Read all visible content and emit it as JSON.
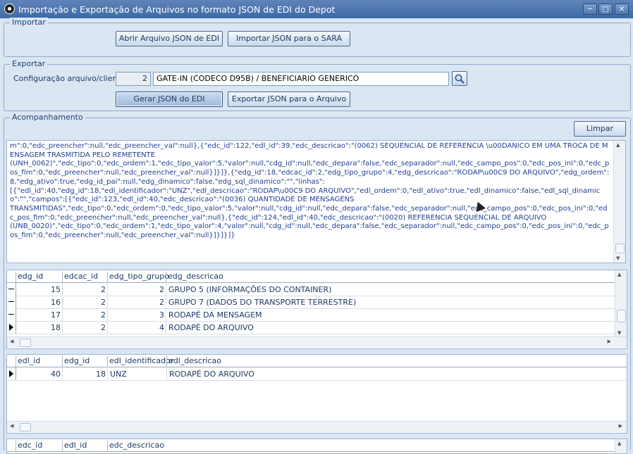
{
  "window": {
    "title": "Importação e Exportação de Arquivos no formato JSON de EDI do Depot",
    "minimize_icon": "minimize-icon",
    "maximize_icon": "maximize-icon",
    "close_icon": "close-icon"
  },
  "importar": {
    "title": "Importar",
    "open_button": "Abrir Arquivo JSON de EDI",
    "import_button": "Importar JSON para o SARA"
  },
  "exportar": {
    "title": "Exportar",
    "config_label": "Configuração arquivo/cliente:",
    "config_id": "2",
    "config_name": "GATE-IN (CODECO D95B) / BENEFICIARIO GENERICO",
    "search_icon": "magnifier-icon",
    "generate_button": "Gerar JSON do EDI",
    "export_button": "Exportar JSON para o Arquivo"
  },
  "acompanhamento": {
    "title": "Acompanhamento",
    "clear_button": "Limpar",
    "log_text": "m\":0,\"edc_preencher\":null,\"edc_preencher_val\":null},{\"edc_id\":122,\"edl_id\":39,\"edc_descricao\":\"(0062) SEQUENCIAL DE REFERENCIA \\u00DANICO EM UMA TROCA DE MENSAGEM TRASMITIDA PELO REMETENTE\n(UNH_0062)\",\"edc_tipo\":0,\"edc_ordem\":1,\"edc_tipo_valor\":5,\"valor\":null,\"cdg_id\":null,\"edc_depara\":false,\"edc_separador\":null,\"edc_campo_pos\":0,\"edc_pos_ini\":0,\"edc_pos_fim\":0,\"edc_preencher\":null,\"edc_preencher_val\":null}]}]},{\"edg_id\":18,\"edcac_id\":2,\"edg_tipo_grupo\":4,\"edg_descricao\":\"RODAP\\u00C9 DO ARQUIVO\",\"edg_ordem\":8,\"edg_ativo\":true,\"edg_id_pai\":null,\"edg_dinamico\":false,\"edg_sql_dinamico\":\"\",\"linhas\":\n[{\"edl_id\":40,\"edg_id\":18,\"edl_identificador\":\"UNZ\",\"edl_descricao\":\"RODAP\\u00C9 DO ARQUIVO\",\"edl_ordem\":0,\"edl_ativo\":true,\"edl_dinamico\":false,\"edl_sql_dinamico\":\"\",\"campos\":[{\"edc_id\":123,\"edl_id\":40,\"edc_descricao\":\"(0036) QUANTIDADE DE MENSAGENS\nTRANSMITIDAS\",\"edc_tipo\":0,\"edc_ordem\":0,\"edc_tipo_valor\":5,\"valor\":null,\"cdg_id\":null,\"edc_depara\":false,\"edc_separador\":null,\"edc_campo_pos\":0,\"edc_pos_ini\":0,\"edc_pos_fim\":0,\"edc_preencher\":null,\"edc_preencher_val\":null},{\"edc_id\":124,\"edl_id\":40,\"edc_descricao\":\"(0020) REFERENCIA SEQUENCIAL DE ARQUIVO\n(UNB_0020)\",\"edc_tipo\":0,\"edc_ordem\":1,\"edc_tipo_valor\":4,\"valor\":null,\"cdg_id\":null,\"edc_depara\":false,\"edc_separador\":null,\"edc_campo_pos\":0,\"edc_pos_ini\":0,\"edc_pos_fim\":0,\"edc_preencher\":null,\"edc_preencher_val\":null}]}]}]}"
  },
  "groups_grid": {
    "columns": [
      "edg_id",
      "edcac_id",
      "edg_tipo_grupo",
      "edg_descricao"
    ],
    "rows": [
      [
        "15",
        "2",
        "2",
        "GRUPO 5 (INFORMAÇÕES DO CONTAINER)"
      ],
      [
        "16",
        "2",
        "2",
        "GRUPO 7 (DADOS DO TRANSPORTE TERRESTRE)"
      ],
      [
        "17",
        "2",
        "3",
        "RODAPÉ DA MENSAGEM"
      ],
      [
        "18",
        "2",
        "4",
        "RODAPÉ DO ARQUIVO"
      ]
    ]
  },
  "lines_grid": {
    "columns": [
      "edl_id",
      "edg_id",
      "edl_identificador",
      "edl_descricao"
    ],
    "rows": [
      [
        "40",
        "18",
        "UNZ",
        "RODAPÉ DO ARQUIVO"
      ]
    ]
  },
  "fields_grid": {
    "columns": [
      "edc_id",
      "edl_id",
      "edc_descricao"
    ]
  }
}
